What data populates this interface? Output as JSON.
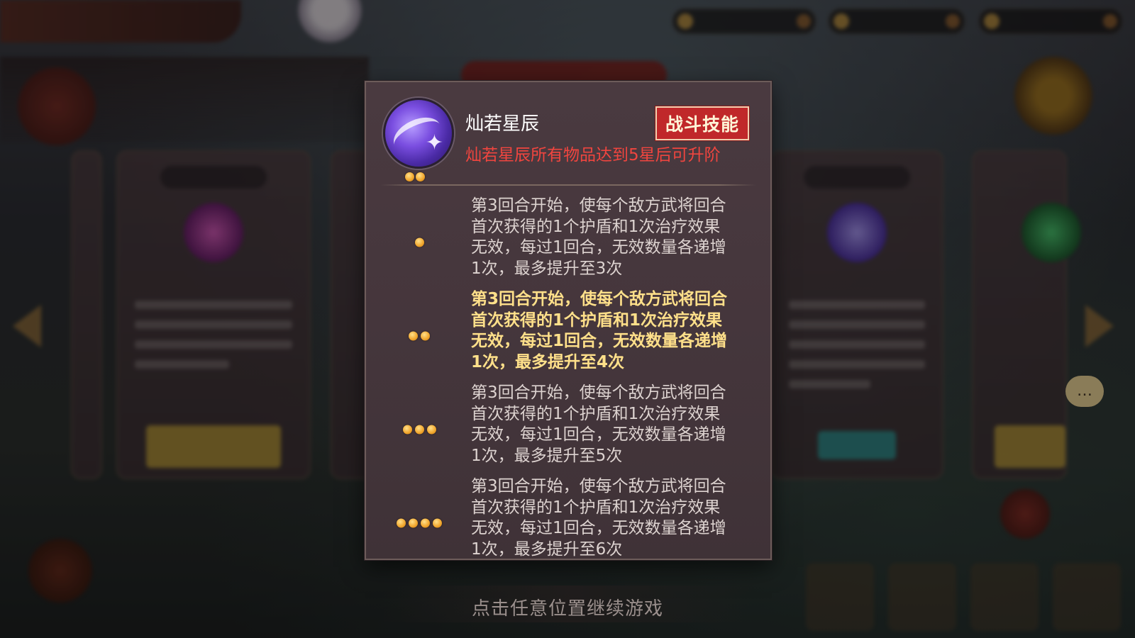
{
  "skill": {
    "name": "灿若星辰",
    "badge": "战斗技能",
    "upgrade_note": "灿若星辰所有物品达到5星后可升阶",
    "icon": "purple-shooting-star-icon",
    "current_stars": 2
  },
  "levels": [
    {
      "stars": 1,
      "text": "第3回合开始，使每个敌方武将回合首次获得的1个护盾和1次治疗效果无效，每过1回合，无效数量各递增1次，最多提升至3次"
    },
    {
      "stars": 2,
      "text": "第3回合开始，使每个敌方武将回合首次获得的1个护盾和1次治疗效果无效，每过1回合，无效数量各递增1次，最多提升至4次",
      "active": true
    },
    {
      "stars": 3,
      "text": "第3回合开始，使每个敌方武将回合首次获得的1个护盾和1次治疗效果无效，每过1回合，无效数量各递增1次，最多提升至5次"
    },
    {
      "stars": 4,
      "text": "第3回合开始，使每个敌方武将回合首次获得的1个护盾和1次治疗效果无效，每过1回合，无效数量各递增1次，最多提升至6次"
    }
  ],
  "continue_hint": "点击任意位置继续游戏",
  "colors": {
    "badge_red": "#c0282a",
    "note_red": "#f0453f",
    "active_text": "#ffe08a",
    "star_gold": "#f0a42a"
  }
}
